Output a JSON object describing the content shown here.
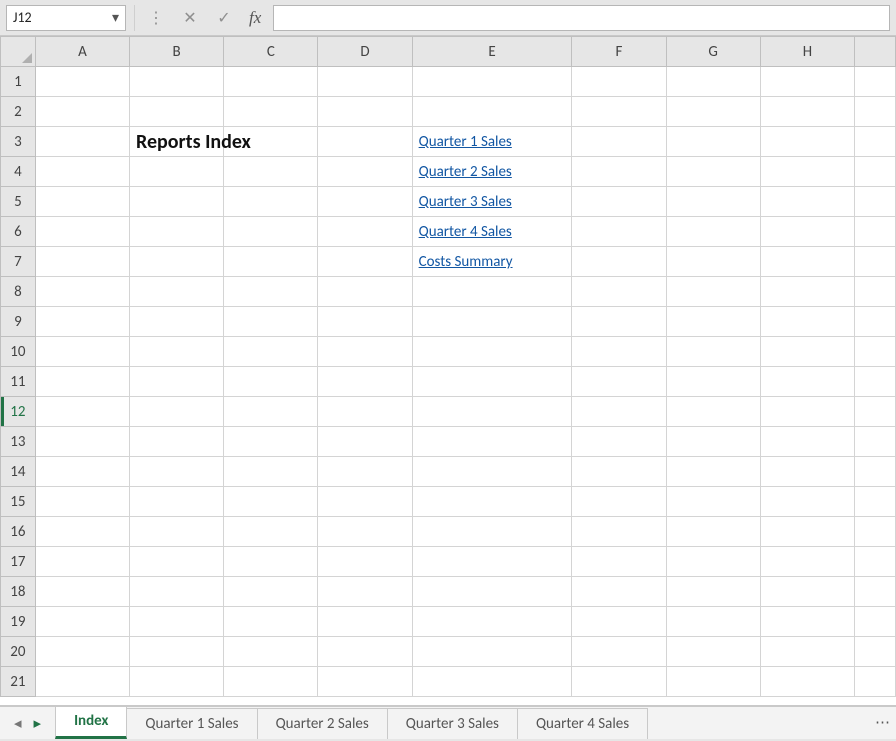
{
  "formula_bar": {
    "cell_ref": "J12",
    "cancel_title": "Cancel",
    "enter_title": "Enter",
    "fx_label": "fx",
    "formula_value": ""
  },
  "columns": [
    "A",
    "B",
    "C",
    "D",
    "E",
    "F",
    "G",
    "H"
  ],
  "row_count": 21,
  "active_row": 12,
  "cells": {
    "heading": "Reports Index",
    "links": [
      "Quarter 1 Sales",
      "Quarter 2 Sales",
      "Quarter 3 Sales",
      "Quarter 4 Sales",
      "Costs Summary"
    ]
  },
  "tabs": {
    "active": "Index",
    "items": [
      "Index",
      "Quarter 1 Sales",
      "Quarter 2 Sales",
      "Quarter 3 Sales",
      "Quarter 4 Sales"
    ]
  }
}
